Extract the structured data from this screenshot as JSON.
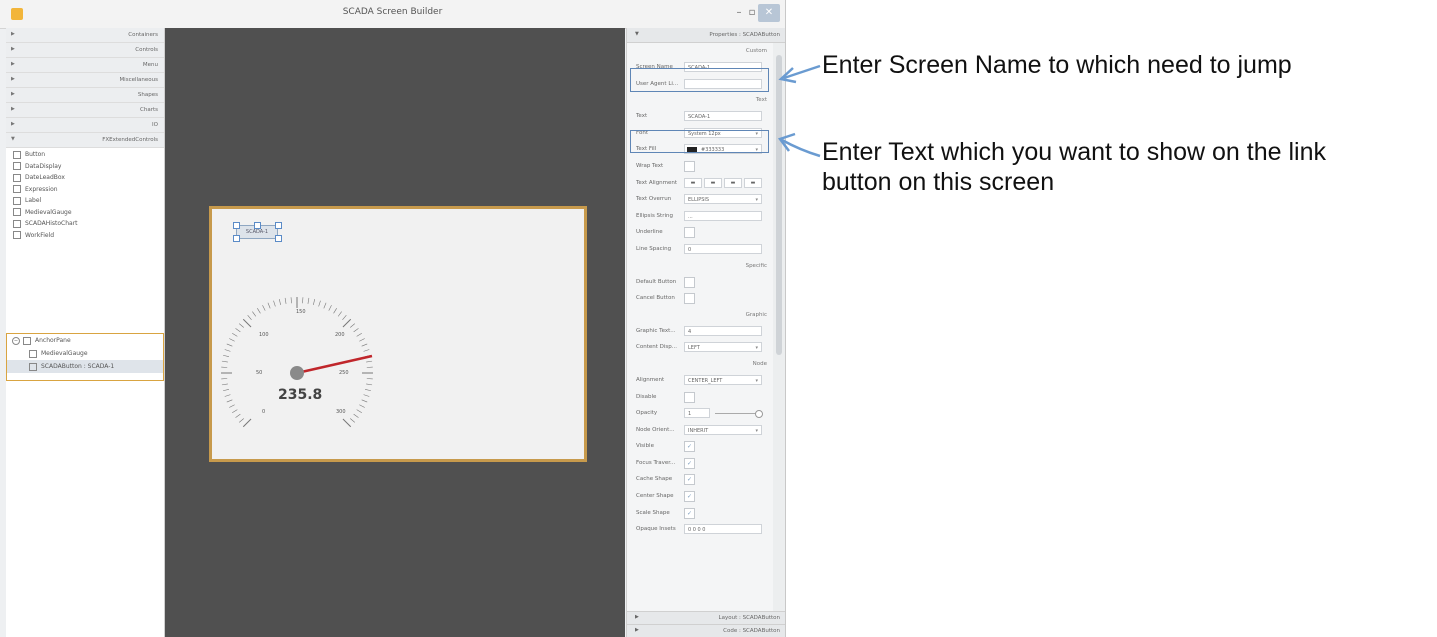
{
  "window": {
    "title": "SCADA Screen Builder",
    "min": "–",
    "max": "▫",
    "close": "✕"
  },
  "left_panel": {
    "sections": [
      "Containers",
      "Controls",
      "Menu",
      "Miscellaneous",
      "Shapes",
      "Charts",
      "IO",
      "FXExtendedControls"
    ],
    "palette": [
      "Button",
      "DataDisplay",
      "DateLeadBox",
      "Expression",
      "Label",
      "MedievalGauge",
      "SCADAHistoChart",
      "WorkField"
    ],
    "tree": {
      "root": "AnchorPane",
      "children": [
        "MedievalGauge",
        "SCADAButton : SCADA-1"
      ]
    }
  },
  "canvas": {
    "selected_button": "SCADA-1",
    "gauge": {
      "value": "235.8",
      "ticks": [
        "0",
        "50",
        "100",
        "150",
        "200",
        "250",
        "300"
      ]
    }
  },
  "properties": {
    "header": "Properties : SCADAButton",
    "sections": {
      "custom": "Custom",
      "text": "Text",
      "specific": "Specific",
      "graphic": "Graphic",
      "node": "Node"
    },
    "rows_custom": [
      {
        "label": "Screen Name",
        "value": "SCADA-1"
      },
      {
        "label": "User Agent Li...",
        "value": ""
      }
    ],
    "rows_text": [
      {
        "label": "Text",
        "value": "SCADA-1"
      },
      {
        "label": "Font",
        "value": "System 12px"
      },
      {
        "label": "Text Fill",
        "value": "#333333"
      },
      {
        "label": "Wrap Text",
        "value": ""
      },
      {
        "label": "Text Alignment",
        "value": ""
      },
      {
        "label": "Text Overrun",
        "value": "ELLIPSIS"
      },
      {
        "label": "Ellipsis String",
        "value": "..."
      },
      {
        "label": "Underline",
        "value": ""
      },
      {
        "label": "Line Spacing",
        "value": "0"
      }
    ],
    "rows_specific": [
      {
        "label": "Default Button",
        "value": ""
      },
      {
        "label": "Cancel Button",
        "value": ""
      }
    ],
    "rows_graphic": [
      {
        "label": "Graphic Text...",
        "value": "4"
      },
      {
        "label": "Content Disp...",
        "value": "LEFT"
      }
    ],
    "rows_node": [
      {
        "label": "Alignment",
        "value": "CENTER_LEFT"
      },
      {
        "label": "Disable",
        "value": ""
      },
      {
        "label": "Opacity",
        "value": "1"
      },
      {
        "label": "Node Orient...",
        "value": "INHERIT"
      },
      {
        "label": "Visible",
        "value": "✓"
      },
      {
        "label": "Focus Traver...",
        "value": "✓"
      },
      {
        "label": "Cache Shape",
        "value": "✓"
      },
      {
        "label": "Center Shape",
        "value": "✓"
      },
      {
        "label": "Scale Shape",
        "value": "✓"
      },
      {
        "label": "Opaque Insets",
        "value": "0  0  0  0"
      }
    ],
    "footer": [
      {
        "label": "Layout : SCADAButton"
      },
      {
        "label": "Code : SCADAButton"
      }
    ]
  },
  "annotations": {
    "note1": "Enter Screen Name to which need to jump",
    "note2": "Enter Text which you want to show on the link button on this screen"
  },
  "colors": {
    "frame": "#c79a4c",
    "canvas": "#505050",
    "highlight": "#5f86b6",
    "needle": "#c0262b"
  }
}
